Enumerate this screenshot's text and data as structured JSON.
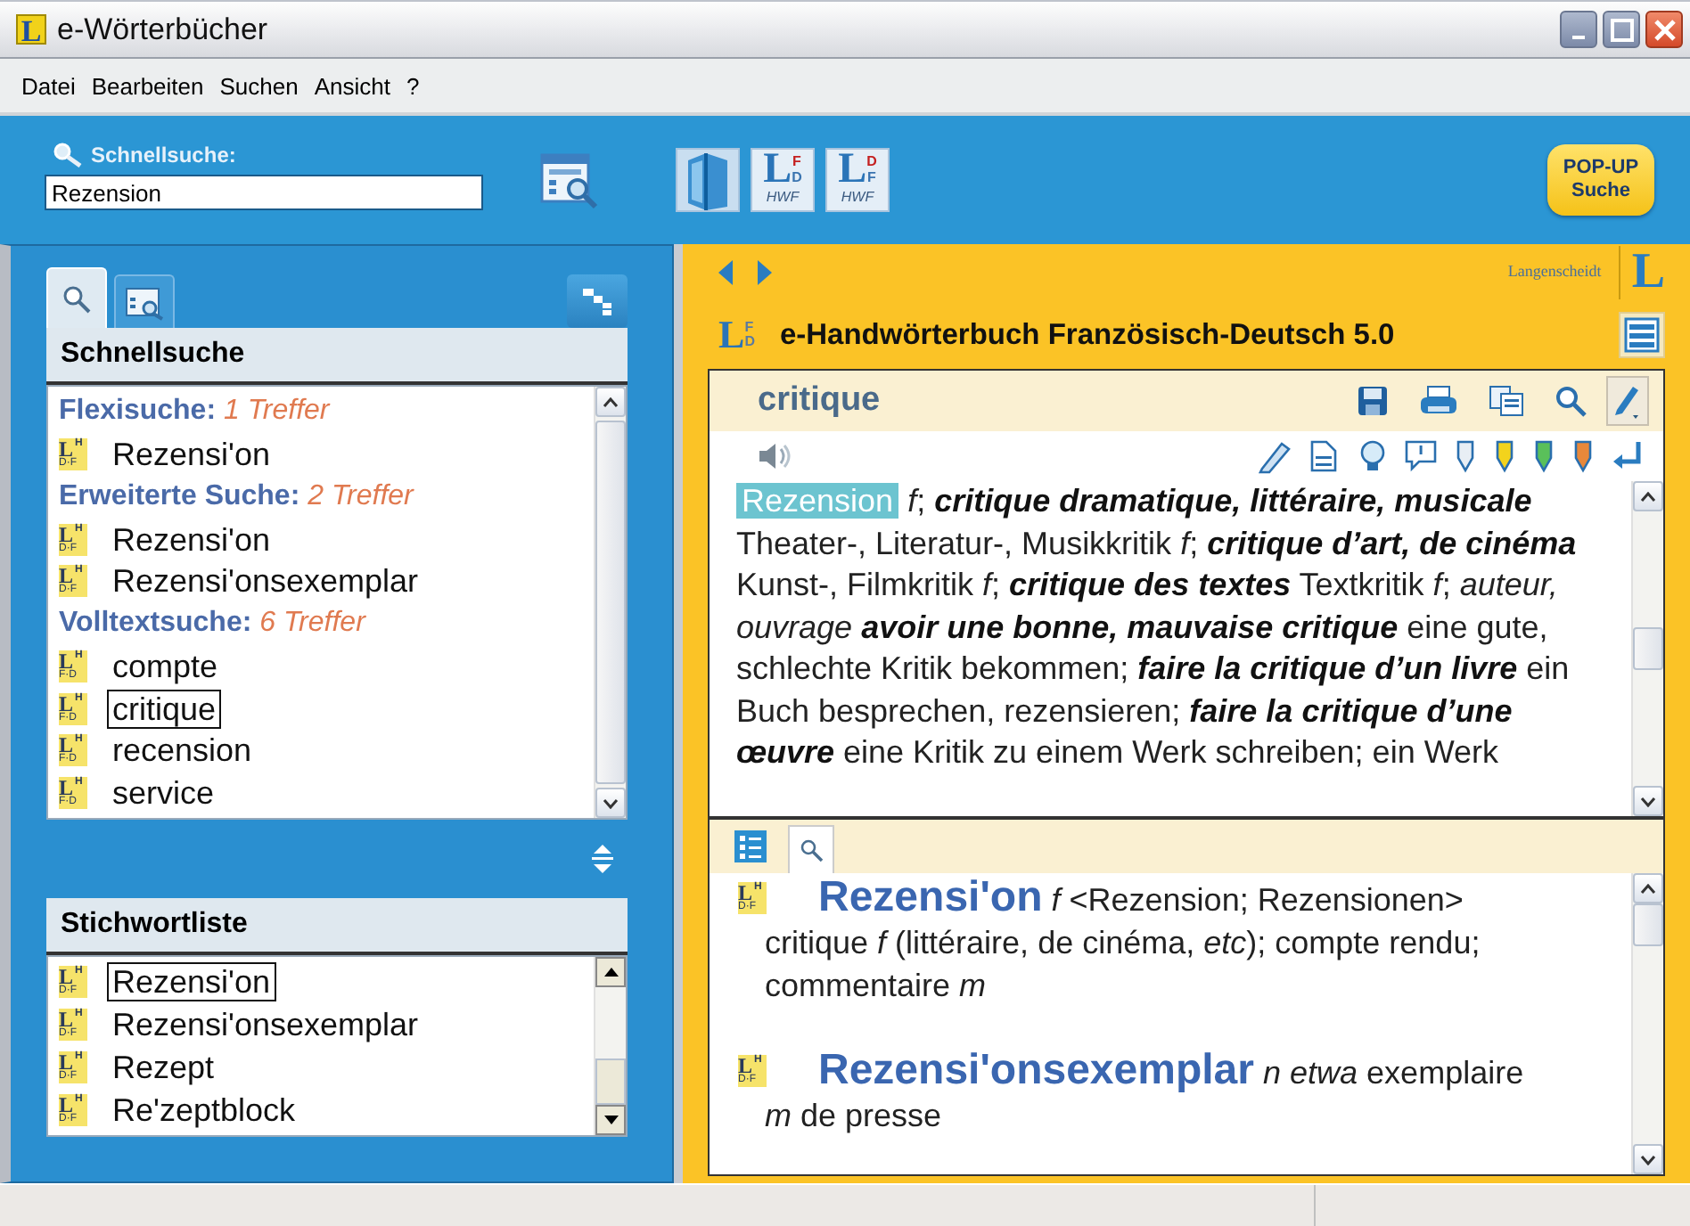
{
  "window": {
    "title": "e-Wörterbücher",
    "logo": "L"
  },
  "menu": [
    "Datei",
    "Bearbeiten",
    "Suchen",
    "Ansicht",
    "?"
  ],
  "toolbar": {
    "search_label": "Schnellsuche:",
    "search_value": "Rezension",
    "dictionaries": [
      {
        "letter": "L",
        "top": "F",
        "bottom": "D",
        "edition": "HWF"
      },
      {
        "letter": "L",
        "top": "D",
        "bottom": "F",
        "edition": "HWF"
      }
    ],
    "popup_button": "POP-UP Suche"
  },
  "left": {
    "tabs": [
      {
        "kind": "search",
        "selected": true
      },
      {
        "kind": "index",
        "selected": false
      }
    ],
    "results": {
      "title": "Schnellsuche",
      "groups": [
        {
          "label": "Flexisuche:",
          "count": "1 Treffer",
          "items": [
            {
              "badge": [
                "L",
                "H",
                "D·F"
              ],
              "text": "Rezensi'on",
              "selected": false
            }
          ]
        },
        {
          "label": "Erweiterte Suche:",
          "count": "2 Treffer",
          "items": [
            {
              "badge": [
                "L",
                "H",
                "D·F"
              ],
              "text": "Rezensi'on",
              "selected": false
            },
            {
              "badge": [
                "L",
                "H",
                "D·F"
              ],
              "text": "Rezensi'onsexemplar",
              "selected": false
            }
          ]
        },
        {
          "label": "Volltextsuche:",
          "count": "6 Treffer",
          "items": [
            {
              "badge": [
                "L",
                "H",
                "F·D"
              ],
              "text": "compte",
              "selected": false
            },
            {
              "badge": [
                "L",
                "H",
                "F·D"
              ],
              "text": "critique",
              "selected": true
            },
            {
              "badge": [
                "L",
                "H",
                "F·D"
              ],
              "text": "recension",
              "selected": false
            },
            {
              "badge": [
                "L",
                "H",
                "F·D"
              ],
              "text": "service",
              "selected": false
            }
          ]
        }
      ]
    },
    "keywords": {
      "title": "Stichwortliste",
      "items": [
        {
          "badge": [
            "L",
            "H",
            "D·F"
          ],
          "text": "Rezensi'on",
          "selected": true
        },
        {
          "badge": [
            "L",
            "H",
            "D·F"
          ],
          "text": "Rezensi'onsexemplar",
          "selected": false
        },
        {
          "badge": [
            "L",
            "H",
            "D·F"
          ],
          "text": "Rezept",
          "selected": false
        },
        {
          "badge": [
            "L",
            "H",
            "D·F"
          ],
          "text": "Re'zeptblock",
          "selected": false
        }
      ]
    }
  },
  "right": {
    "brand": "Langenscheidt",
    "brand_letter": "L",
    "dictionary": {
      "letter": "L",
      "top": "F",
      "bottom": "D",
      "title": "e-Handwörterbuch Französisch-Deutsch 5.0"
    },
    "headword": "critique",
    "highlight": "Rezension",
    "definition": "*f*; **critique dramatique, littéraire, musicale** Theater-, Literatur-, Musikkritik *f*; **critique d’art, de cinéma** Kunst-, Filmkritik *f*; **critique des textes** Textkritik *f*; *auteur, ouvrage* **avoir une bonne, mauvaise critique** eine gute, schlechte Kritik bekommen; **faire la critique d’un livre** ein Buch besprechen, rezensieren; **faire la critique d’une œuvre** eine Kritik zu einem Werk schreiben; ein Werk",
    "lower_tabs": [
      {
        "kind": "list",
        "selected": false
      },
      {
        "kind": "search",
        "selected": true
      }
    ],
    "entries": [
      {
        "badge": [
          "L",
          "H",
          "D·F"
        ],
        "headword": "Rezensi'on",
        "text": "*f* <Rezension; Rezensionen> critique *f* (littéraire, de cinéma, *etc*); compte rendu; commentaire *m*"
      },
      {
        "badge": [
          "L",
          "H",
          "D·F"
        ],
        "headword": "Rezensi'onsexemplar",
        "text": "*n etwa* exemplaire *m* de presse"
      }
    ]
  }
}
